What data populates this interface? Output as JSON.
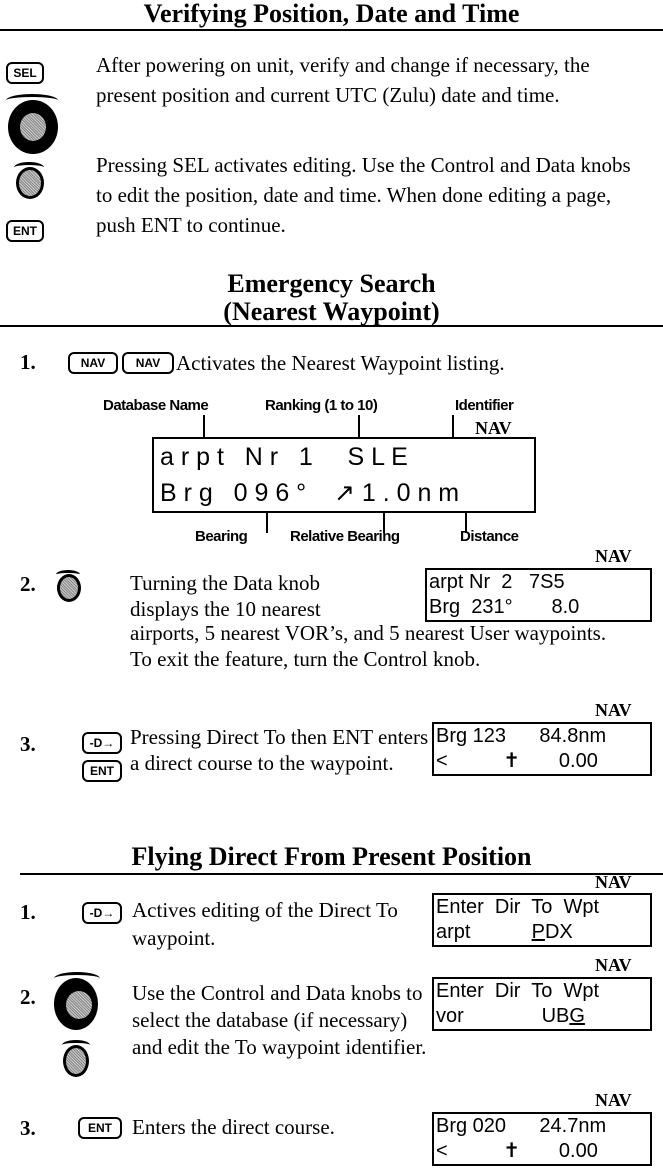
{
  "section1": {
    "title": "Verifying Position, Date and Time",
    "para1": "After powering on unit, verify and change if necessary, the present position and current UTC (Zulu) date and time.",
    "para2": "Pressing SEL activates editing.  Use the Control and Data knobs to edit the position, date and time.  When done editing a page, push ENT to continue.",
    "sel_button": "SEL",
    "ent_button": "ENT"
  },
  "section2": {
    "title_line1": "Emergency Search",
    "title_line2": "(Nearest Waypoint)",
    "step1": {
      "num": "1.",
      "nav_button": "NAV",
      "text": "Activates the Nearest Waypoint listing."
    },
    "diagram": {
      "label_database": "Database Name",
      "label_ranking": "Ranking (1 to 10)",
      "label_identifier": "Identifier",
      "nav": "NAV",
      "line1": "a r p t   N r   1     S L E",
      "line2": "B r g   0 9 6 °    ↗ 1 . 0 n m",
      "label_bearing": "Bearing",
      "label_relative": "Relative Bearing",
      "label_distance": "Distance"
    },
    "step2": {
      "num": "2.",
      "text": "Turning the Data knob displays the 10 nearest airports,  5 nearest VOR’s, and 5 nearest User waypoints. To exit the feature, turn the Control knob.",
      "text_a": "Turning the Data knob",
      "text_b": "displays the 10 nearest",
      "text_c": "airports,  5 nearest VOR’s, and 5 nearest User waypoints. To exit the feature, turn the Control knob.",
      "nav": "NAV",
      "lcd1": "arpt Nr  2   7S5",
      "lcd2": "Brg  231°       8.0"
    },
    "step3": {
      "num": "3.",
      "direct_button": "-D→",
      "ent_button": "ENT",
      "text": "Pressing Direct To then ENT enters a direct course to the waypoint.",
      "nav": "NAV",
      "lcd1": "Brg 123      84.8nm",
      "lcd2": "<          ✝       0.00"
    }
  },
  "section3": {
    "title": "Flying Direct From Present Position",
    "step1": {
      "num": "1.",
      "direct_button": "-D→",
      "text": "Actives editing of the Direct To waypoint.",
      "nav": "NAV",
      "lcd1": "Enter  Dir  To  Wpt",
      "lcd2a": "arpt           ",
      "lcd2b": "P",
      "lcd2c": "DX"
    },
    "step2": {
      "num": "2.",
      "text": "Use the Control and Data knobs to select the database (if necessary) and edit the To waypoint identifier.",
      "nav": "NAV",
      "lcd1": "Enter  Dir  To  Wpt",
      "lcd2a": "vor              UB",
      "lcd2b": "G"
    },
    "step3": {
      "num": "3.",
      "ent_button": "ENT",
      "text": "Enters the direct course.",
      "nav": "NAV",
      "lcd1": "Brg 020      24.7nm",
      "lcd2": "<          ✝       0.00"
    }
  }
}
